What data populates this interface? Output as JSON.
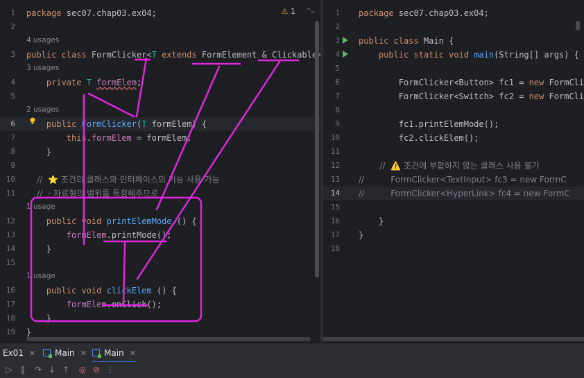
{
  "left_editor": {
    "warning_count": "1",
    "lines": [
      {
        "num": "1",
        "tokens": [
          {
            "c": "kw",
            "t": "package "
          },
          {
            "c": "plain",
            "t": "sec07.chap03.ex04;"
          }
        ]
      },
      {
        "num": "2",
        "tokens": []
      },
      {
        "num": "3",
        "hint": "4 usages",
        "tokens": [
          {
            "c": "kw",
            "t": "public class "
          },
          {
            "c": "cls",
            "t": "FormClicker<"
          },
          {
            "c": "tp",
            "t": "T"
          },
          {
            "c": "kw",
            "t": " extends "
          },
          {
            "c": "cls",
            "t": "FormElement & Clickable> {"
          }
        ]
      },
      {
        "num": "",
        "tokens": []
      },
      {
        "num": "4",
        "hint": "3 usages",
        "tokens": [
          {
            "c": "kw",
            "t": "    private "
          },
          {
            "c": "tp",
            "t": "T"
          },
          {
            "c": "plain",
            "t": " "
          },
          {
            "c": "fld squiggle",
            "t": "formElem"
          },
          {
            "c": "plain",
            "t": ";"
          }
        ]
      },
      {
        "num": "5",
        "tokens": []
      },
      {
        "num": "6",
        "hint": "2 usages",
        "tokens": [
          {
            "c": "kw",
            "t": "    public "
          },
          {
            "c": "fn",
            "t": "FormClicker"
          },
          {
            "c": "plain",
            "t": "("
          },
          {
            "c": "tp",
            "t": "T"
          },
          {
            "c": "plain",
            "t": " formElem) {"
          }
        ]
      },
      {
        "num": "7",
        "tokens": [
          {
            "c": "kw",
            "t": "        this"
          },
          {
            "c": "plain",
            "t": "."
          },
          {
            "c": "fld",
            "t": "formElem"
          },
          {
            "c": "plain",
            "t": " = formElem;"
          }
        ]
      },
      {
        "num": "8",
        "tokens": [
          {
            "c": "plain",
            "t": "    }"
          }
        ]
      },
      {
        "num": "9",
        "tokens": []
      },
      {
        "num": "10",
        "tokens": [
          {
            "c": "cm",
            "t": "    //  ⭐ 조건의 클래스와 인터페이스의 기능 사용 가능"
          }
        ]
      },
      {
        "num": "11",
        "tokens": [
          {
            "c": "cm",
            "t": "    //  - 자료형의 범위를 특정해주므로"
          }
        ]
      },
      {
        "num": "12",
        "hint": "1 usage",
        "tokens": [
          {
            "c": "kw",
            "t": "    public void "
          },
          {
            "c": "fn",
            "t": "printElemMode"
          },
          {
            "c": "plain",
            "t": " () {"
          }
        ]
      },
      {
        "num": "13",
        "tokens": [
          {
            "c": "fld",
            "t": "        formElem"
          },
          {
            "c": "plain",
            "t": ".printMode();"
          }
        ]
      },
      {
        "num": "14",
        "tokens": [
          {
            "c": "plain",
            "t": "    }"
          }
        ]
      },
      {
        "num": "15",
        "tokens": []
      },
      {
        "num": "16",
        "hint": "1 usage",
        "tokens": [
          {
            "c": "kw",
            "t": "    public void "
          },
          {
            "c": "fn",
            "t": "clickElem"
          },
          {
            "c": "plain",
            "t": " () {"
          }
        ]
      },
      {
        "num": "17",
        "tokens": [
          {
            "c": "fld",
            "t": "        formElem"
          },
          {
            "c": "plain",
            "t": ".onClick();"
          }
        ]
      },
      {
        "num": "18",
        "tokens": [
          {
            "c": "plain",
            "t": "    }"
          }
        ]
      },
      {
        "num": "19",
        "tokens": [
          {
            "c": "plain",
            "t": "}"
          }
        ]
      }
    ]
  },
  "right_editor": {
    "lines": [
      {
        "num": "1",
        "tokens": [
          {
            "c": "kw",
            "t": "package "
          },
          {
            "c": "plain",
            "t": "sec07.chap03.ex04;"
          }
        ]
      },
      {
        "num": "2",
        "tokens": []
      },
      {
        "num": "3",
        "tokens": [
          {
            "c": "kw",
            "t": "public class "
          },
          {
            "c": "cls",
            "t": "Main {"
          }
        ]
      },
      {
        "num": "4",
        "tokens": [
          {
            "c": "kw",
            "t": "    public static void "
          },
          {
            "c": "fn",
            "t": "main"
          },
          {
            "c": "plain",
            "t": "(String[] args) {"
          }
        ]
      },
      {
        "num": "5",
        "tokens": []
      },
      {
        "num": "6",
        "tokens": [
          {
            "c": "plain",
            "t": "        FormClicker<Button> fc1 = "
          },
          {
            "c": "kw",
            "t": "new "
          },
          {
            "c": "plain",
            "t": "FormClicker"
          }
        ]
      },
      {
        "num": "7",
        "tokens": [
          {
            "c": "plain",
            "t": "        FormClicker<Switch> fc2 = "
          },
          {
            "c": "kw",
            "t": "new "
          },
          {
            "c": "plain",
            "t": "FormClicker"
          }
        ]
      },
      {
        "num": "8",
        "tokens": []
      },
      {
        "num": "9",
        "tokens": [
          {
            "c": "plain",
            "t": "        fc1.printElemMode();"
          }
        ]
      },
      {
        "num": "10",
        "tokens": [
          {
            "c": "plain",
            "t": "        fc2.clickElem();"
          }
        ]
      },
      {
        "num": "11",
        "tokens": []
      },
      {
        "num": "12",
        "tokens": [
          {
            "c": "cm",
            "t": "        //  ⚠️ 조건에 부합하지 않는 클래스 사용 불가"
          }
        ]
      },
      {
        "num": "13",
        "tokens": [
          {
            "c": "cm",
            "t": "//          FormClicker<TextInput> fc3 = new FormC"
          }
        ]
      },
      {
        "num": "14",
        "tokens": [
          {
            "c": "cm",
            "t": "//          FormClicker<HyperLink> fc4 = new FormC"
          }
        ]
      },
      {
        "num": "15",
        "tokens": []
      },
      {
        "num": "16",
        "tokens": [
          {
            "c": "plain",
            "t": "    }"
          }
        ]
      },
      {
        "num": "17",
        "tokens": [
          {
            "c": "plain",
            "t": "}"
          }
        ]
      },
      {
        "num": "18",
        "tokens": []
      }
    ]
  },
  "bottom_tabs": [
    {
      "label": "Ex01"
    },
    {
      "label": "Main"
    },
    {
      "label": "Main"
    }
  ],
  "colors": {
    "annotation": "#e026e0",
    "keyword": "#cf8e6d",
    "function": "#56a8f5",
    "field": "#c77dbb",
    "type_param": "#16baac"
  }
}
